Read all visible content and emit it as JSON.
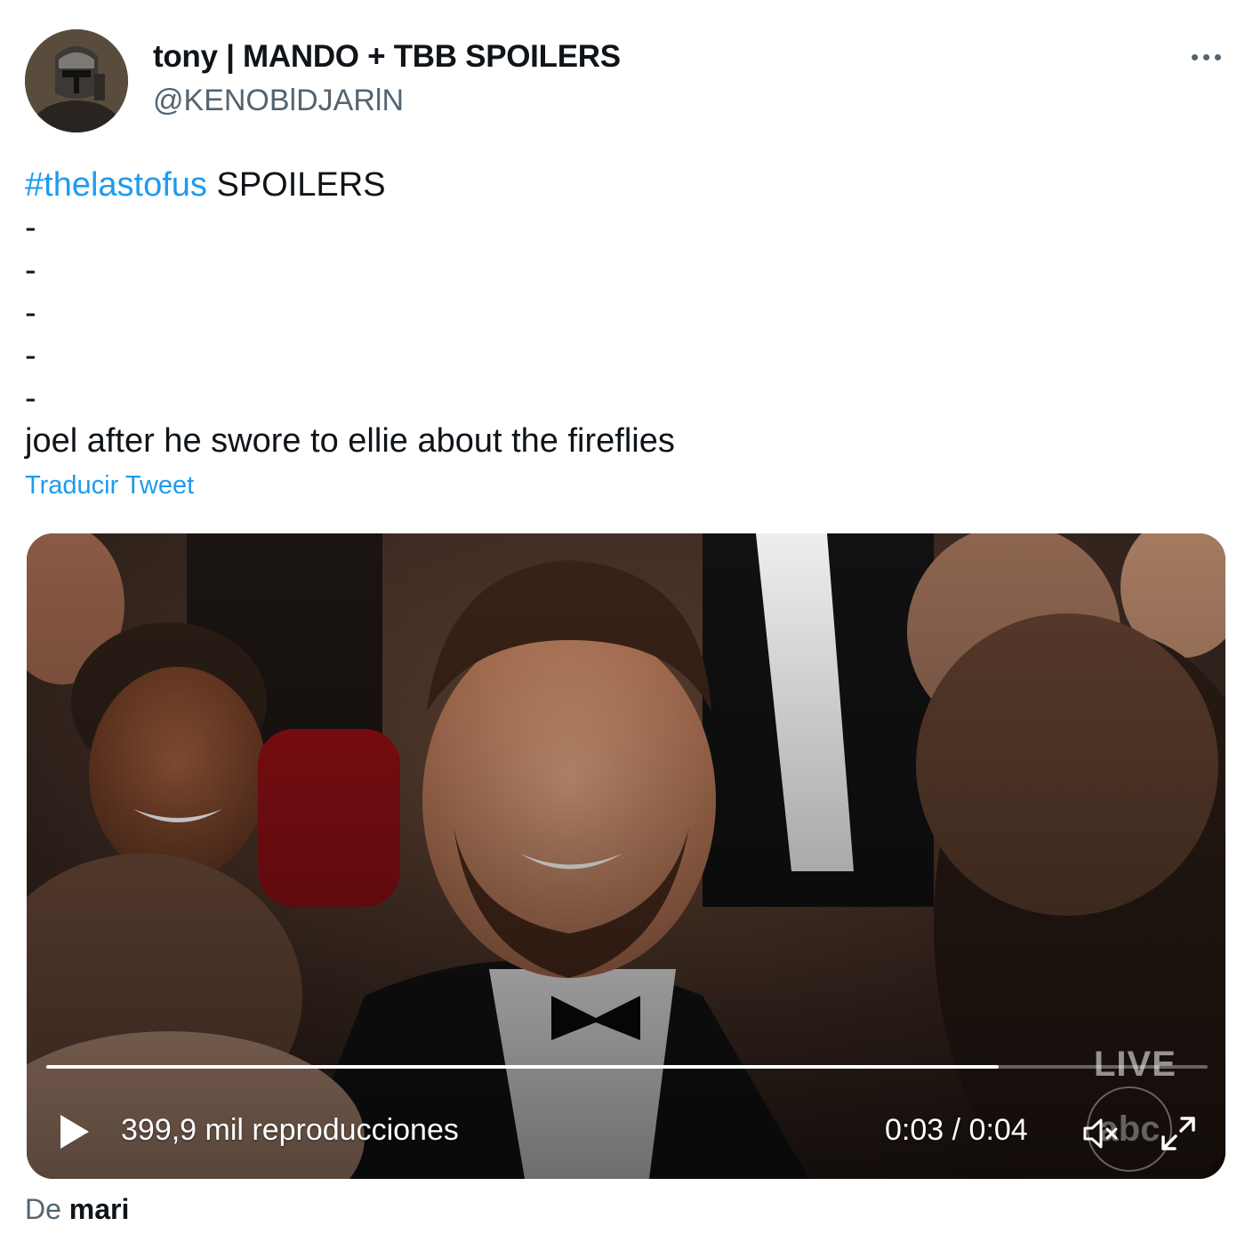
{
  "author": {
    "display_name": "tony | MANDO + TBB SPOILERS",
    "handle": "@KENOBlDJARlN",
    "avatar_icon": "helmet-avatar-icon"
  },
  "header": {
    "more_icon": "more-horizontal-icon"
  },
  "body": {
    "hashtag": "#thelastofus",
    "first_line_rest": " SPOILERS",
    "dash_lines": [
      "-",
      "-",
      "-",
      "-",
      "-"
    ],
    "last_line": "joel after he swore to ellie about the fireflies",
    "translate_label": "Traducir Tweet"
  },
  "media": {
    "type": "video",
    "views_label": "399,9 mil reproducciones",
    "current_time": "0:03",
    "duration": "0:04",
    "time_separator": " / ",
    "progress": 0.82,
    "live_badge": "LIVE",
    "watermark": "abc",
    "play_icon": "play-icon",
    "mute_icon": "muted-speaker-icon",
    "fullscreen_icon": "expand-icon"
  },
  "attribution": {
    "prefix": "De ",
    "source": "mari"
  },
  "colors": {
    "link": "#1d9bf0",
    "text": "#0f1419",
    "secondary": "#536471"
  }
}
